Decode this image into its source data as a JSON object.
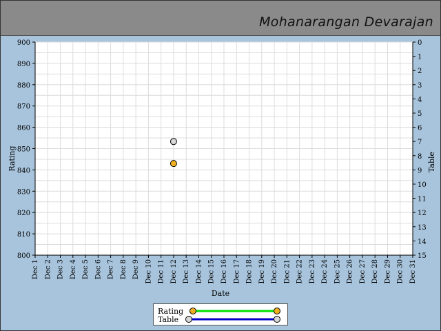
{
  "title": "Mohanarangan Devarajan",
  "colors": {
    "background": "#a8c4dc",
    "header": "#8a8a8a",
    "rating_line": "#00e000",
    "rating_marker": "#f0b020",
    "table_line": "#0000c8",
    "table_marker": "#d8d8d8"
  },
  "legend": {
    "rating": "Rating",
    "table": "Table"
  },
  "chart_data": {
    "type": "scatter",
    "xlabel": "Date",
    "ylabel": "Rating",
    "y2label": "Table",
    "ylim": [
      800,
      900
    ],
    "y2lim": [
      0,
      15
    ],
    "y_ticks": [
      900,
      890,
      880,
      870,
      860,
      850,
      840,
      830,
      820,
      810,
      800
    ],
    "y2_ticks": [
      0,
      1,
      2,
      3,
      4,
      5,
      6,
      7,
      8,
      9,
      10,
      11,
      12,
      13,
      14,
      15
    ],
    "categories": [
      "Dec 1",
      "Dec 2",
      "Dec 3",
      "Dec 4",
      "Dec 5",
      "Dec 6",
      "Dec 7",
      "Dec 8",
      "Dec 9",
      "Dec 10",
      "Dec 11",
      "Dec 12",
      "Dec 13",
      "Dec 14",
      "Dec 15",
      "Dec 16",
      "Dec 17",
      "Dec 18",
      "Dec 19",
      "Dec 20",
      "Dec 21",
      "Dec 22",
      "Dec 23",
      "Dec 24",
      "Dec 25",
      "Dec 26",
      "Dec 27",
      "Dec 28",
      "Dec 29",
      "Dec 30",
      "Dec 31"
    ],
    "grid": true,
    "legend_position": "bottom",
    "series": [
      {
        "name": "Rating",
        "axis": "left",
        "points": [
          {
            "x": "Dec 12",
            "y": 843
          }
        ]
      },
      {
        "name": "Table",
        "axis": "right",
        "points": [
          {
            "x": "Dec 12",
            "y": 7
          }
        ]
      }
    ]
  }
}
